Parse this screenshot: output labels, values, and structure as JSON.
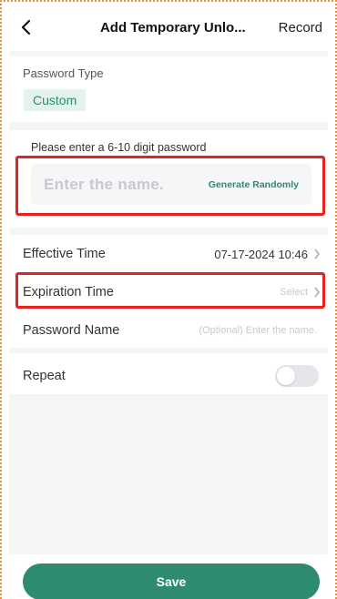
{
  "header": {
    "title": "Add Temporary Unlo...",
    "record_label": "Record"
  },
  "password_type": {
    "label": "Password Type",
    "selected": "Custom"
  },
  "password": {
    "hint": "Please enter a 6-10 digit password",
    "placeholder": "Enter the name.",
    "generate_label": "Generate Randomly"
  },
  "effective_time": {
    "label": "Effective Time",
    "value": "07-17-2024 10:46"
  },
  "expiration_time": {
    "label": "Expiration Time",
    "value": "Select"
  },
  "password_name": {
    "label": "Password Name",
    "placeholder": "(Optional) Enter the name."
  },
  "repeat": {
    "label": "Repeat",
    "enabled": false
  },
  "save_label": "Save",
  "colors": {
    "accent": "#2e8b70",
    "highlight": "#e6231c",
    "background_gray": "#f4f5f7"
  }
}
